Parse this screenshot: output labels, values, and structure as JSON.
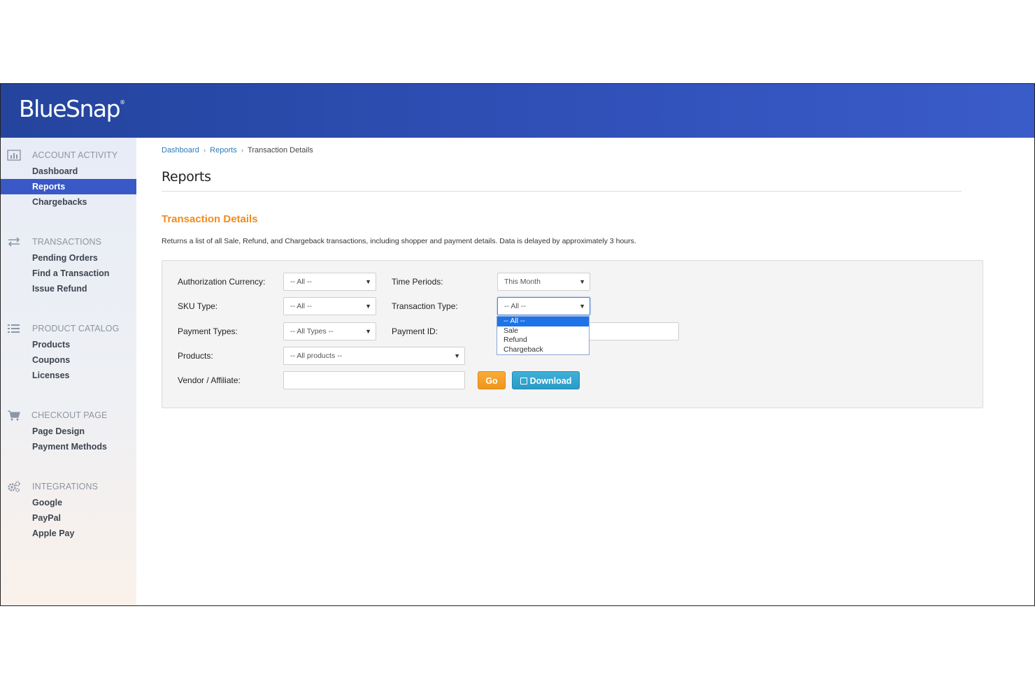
{
  "brand": {
    "name": "BlueSnap",
    "mark": "®"
  },
  "sidebar": {
    "sections": [
      {
        "title": "ACCOUNT ACTIVITY",
        "icon": "bar-chart-icon",
        "items": [
          {
            "label": "Dashboard"
          },
          {
            "label": "Reports",
            "active": true
          },
          {
            "label": "Chargebacks"
          }
        ]
      },
      {
        "title": "TRANSACTIONS",
        "icon": "transfer-arrows-icon",
        "items": [
          {
            "label": "Pending Orders"
          },
          {
            "label": "Find a Transaction"
          },
          {
            "label": "Issue Refund"
          }
        ]
      },
      {
        "title": "PRODUCT CATALOG",
        "icon": "list-icon",
        "items": [
          {
            "label": "Products"
          },
          {
            "label": "Coupons"
          },
          {
            "label": "Licenses"
          }
        ]
      },
      {
        "title": "CHECKOUT PAGE",
        "icon": "cart-icon",
        "items": [
          {
            "label": "Page Design"
          },
          {
            "label": "Payment Methods"
          }
        ]
      },
      {
        "title": "INTEGRATIONS",
        "icon": "gears-icon",
        "items": [
          {
            "label": "Google"
          },
          {
            "label": "PayPal"
          },
          {
            "label": "Apple Pay"
          }
        ]
      }
    ]
  },
  "breadcrumb": {
    "items": [
      "Dashboard",
      "Reports",
      "Transaction Details"
    ],
    "separator": "›"
  },
  "page": {
    "title": "Reports",
    "section_title": "Transaction Details",
    "description": "Returns a list of all Sale, Refund, and Chargeback transactions, including shopper and payment details. Data is delayed by approximately 3 hours."
  },
  "filters": {
    "auth_currency": {
      "label": "Authorization Currency:",
      "value": "-- All --"
    },
    "sku_type": {
      "label": "SKU Type:",
      "value": "-- All --"
    },
    "payment_types": {
      "label": "Payment Types:",
      "value": "-- All Types --"
    },
    "products": {
      "label": "Products:",
      "value": "-- All products --"
    },
    "vendor": {
      "label": "Vendor / Affiliate:",
      "value": ""
    },
    "time_periods": {
      "label": "Time Periods:",
      "value": "This Month"
    },
    "transaction_type": {
      "label": "Transaction Type:",
      "value": "-- All --",
      "options": [
        "-- All --",
        "Sale",
        "Refund",
        "Chargeback"
      ],
      "open": true
    },
    "payment_id": {
      "label": "Payment ID:",
      "value": ""
    }
  },
  "buttons": {
    "go": "Go",
    "download": "Download"
  },
  "colors": {
    "header": "#2f4fb6",
    "active_nav": "#3859c6",
    "accent_orange": "#f18c1b",
    "go_button": "#f5a52c",
    "download_button": "#35a6cf",
    "link": "#2a7ab8"
  }
}
